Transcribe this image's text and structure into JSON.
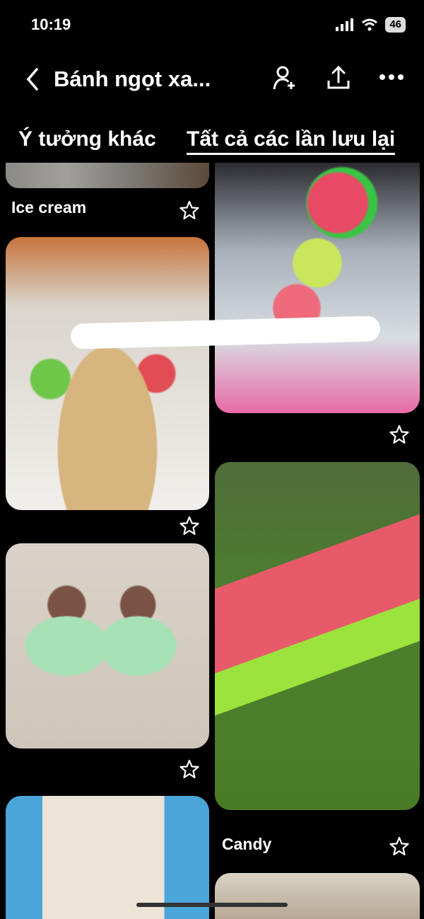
{
  "status": {
    "time": "10:19",
    "battery": "46"
  },
  "header": {
    "title": "Bánh ngọt xa..."
  },
  "tabs": [
    {
      "label": "Ý tưởng khác",
      "active": false
    },
    {
      "label": "Tất cả các lần lưu lại",
      "active": true
    }
  ],
  "pins": {
    "left": [
      {
        "label": "Ice cream"
      },
      {
        "label": ""
      },
      {
        "label": ""
      },
      {
        "label": ""
      }
    ],
    "right": [
      {
        "label": ""
      },
      {
        "label": "Candy"
      },
      {
        "label": ""
      }
    ]
  },
  "colors": {
    "background": "#000000",
    "text": "#ffffff"
  },
  "icons": [
    "back-icon",
    "add-collaborator-icon",
    "share-icon",
    "more-icon",
    "star-icon",
    "signal-icon",
    "wifi-icon"
  ]
}
